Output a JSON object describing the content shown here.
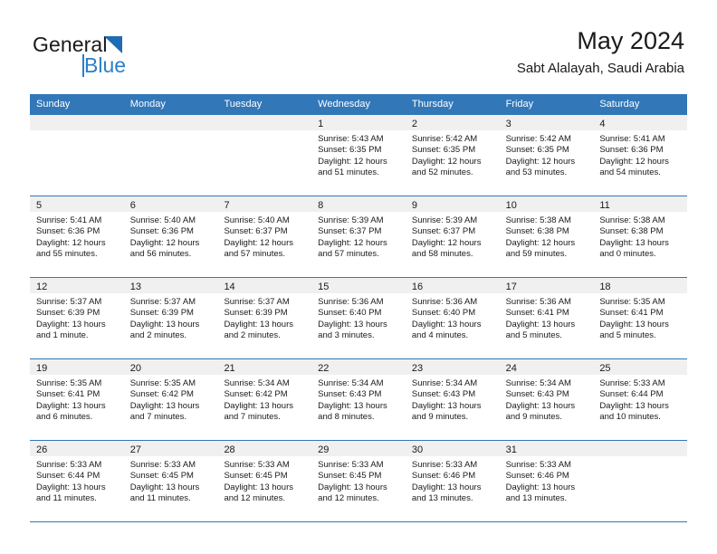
{
  "brand": {
    "name_top": "General",
    "name_bottom": "Blue",
    "color_black": "#1a1a1a",
    "color_blue": "#2a7fc9"
  },
  "header": {
    "title": "May 2024",
    "subtitle": "Sabt Alalayah, Saudi Arabia"
  },
  "calendar": {
    "header_bg": "#3277b8",
    "daynum_bg": "#f0f0f0",
    "day_names": [
      "Sunday",
      "Monday",
      "Tuesday",
      "Wednesday",
      "Thursday",
      "Friday",
      "Saturday"
    ],
    "weeks": [
      [
        {
          "day": "",
          "lines": []
        },
        {
          "day": "",
          "lines": []
        },
        {
          "day": "",
          "lines": []
        },
        {
          "day": "1",
          "lines": [
            "Sunrise: 5:43 AM",
            "Sunset: 6:35 PM",
            "Daylight: 12 hours",
            "and 51 minutes."
          ]
        },
        {
          "day": "2",
          "lines": [
            "Sunrise: 5:42 AM",
            "Sunset: 6:35 PM",
            "Daylight: 12 hours",
            "and 52 minutes."
          ]
        },
        {
          "day": "3",
          "lines": [
            "Sunrise: 5:42 AM",
            "Sunset: 6:35 PM",
            "Daylight: 12 hours",
            "and 53 minutes."
          ]
        },
        {
          "day": "4",
          "lines": [
            "Sunrise: 5:41 AM",
            "Sunset: 6:36 PM",
            "Daylight: 12 hours",
            "and 54 minutes."
          ]
        }
      ],
      [
        {
          "day": "5",
          "lines": [
            "Sunrise: 5:41 AM",
            "Sunset: 6:36 PM",
            "Daylight: 12 hours",
            "and 55 minutes."
          ]
        },
        {
          "day": "6",
          "lines": [
            "Sunrise: 5:40 AM",
            "Sunset: 6:36 PM",
            "Daylight: 12 hours",
            "and 56 minutes."
          ]
        },
        {
          "day": "7",
          "lines": [
            "Sunrise: 5:40 AM",
            "Sunset: 6:37 PM",
            "Daylight: 12 hours",
            "and 57 minutes."
          ]
        },
        {
          "day": "8",
          "lines": [
            "Sunrise: 5:39 AM",
            "Sunset: 6:37 PM",
            "Daylight: 12 hours",
            "and 57 minutes."
          ]
        },
        {
          "day": "9",
          "lines": [
            "Sunrise: 5:39 AM",
            "Sunset: 6:37 PM",
            "Daylight: 12 hours",
            "and 58 minutes."
          ]
        },
        {
          "day": "10",
          "lines": [
            "Sunrise: 5:38 AM",
            "Sunset: 6:38 PM",
            "Daylight: 12 hours",
            "and 59 minutes."
          ]
        },
        {
          "day": "11",
          "lines": [
            "Sunrise: 5:38 AM",
            "Sunset: 6:38 PM",
            "Daylight: 13 hours",
            "and 0 minutes."
          ]
        }
      ],
      [
        {
          "day": "12",
          "lines": [
            "Sunrise: 5:37 AM",
            "Sunset: 6:39 PM",
            "Daylight: 13 hours",
            "and 1 minute."
          ]
        },
        {
          "day": "13",
          "lines": [
            "Sunrise: 5:37 AM",
            "Sunset: 6:39 PM",
            "Daylight: 13 hours",
            "and 2 minutes."
          ]
        },
        {
          "day": "14",
          "lines": [
            "Sunrise: 5:37 AM",
            "Sunset: 6:39 PM",
            "Daylight: 13 hours",
            "and 2 minutes."
          ]
        },
        {
          "day": "15",
          "lines": [
            "Sunrise: 5:36 AM",
            "Sunset: 6:40 PM",
            "Daylight: 13 hours",
            "and 3 minutes."
          ]
        },
        {
          "day": "16",
          "lines": [
            "Sunrise: 5:36 AM",
            "Sunset: 6:40 PM",
            "Daylight: 13 hours",
            "and 4 minutes."
          ]
        },
        {
          "day": "17",
          "lines": [
            "Sunrise: 5:36 AM",
            "Sunset: 6:41 PM",
            "Daylight: 13 hours",
            "and 5 minutes."
          ]
        },
        {
          "day": "18",
          "lines": [
            "Sunrise: 5:35 AM",
            "Sunset: 6:41 PM",
            "Daylight: 13 hours",
            "and 5 minutes."
          ]
        }
      ],
      [
        {
          "day": "19",
          "lines": [
            "Sunrise: 5:35 AM",
            "Sunset: 6:41 PM",
            "Daylight: 13 hours",
            "and 6 minutes."
          ]
        },
        {
          "day": "20",
          "lines": [
            "Sunrise: 5:35 AM",
            "Sunset: 6:42 PM",
            "Daylight: 13 hours",
            "and 7 minutes."
          ]
        },
        {
          "day": "21",
          "lines": [
            "Sunrise: 5:34 AM",
            "Sunset: 6:42 PM",
            "Daylight: 13 hours",
            "and 7 minutes."
          ]
        },
        {
          "day": "22",
          "lines": [
            "Sunrise: 5:34 AM",
            "Sunset: 6:43 PM",
            "Daylight: 13 hours",
            "and 8 minutes."
          ]
        },
        {
          "day": "23",
          "lines": [
            "Sunrise: 5:34 AM",
            "Sunset: 6:43 PM",
            "Daylight: 13 hours",
            "and 9 minutes."
          ]
        },
        {
          "day": "24",
          "lines": [
            "Sunrise: 5:34 AM",
            "Sunset: 6:43 PM",
            "Daylight: 13 hours",
            "and 9 minutes."
          ]
        },
        {
          "day": "25",
          "lines": [
            "Sunrise: 5:33 AM",
            "Sunset: 6:44 PM",
            "Daylight: 13 hours",
            "and 10 minutes."
          ]
        }
      ],
      [
        {
          "day": "26",
          "lines": [
            "Sunrise: 5:33 AM",
            "Sunset: 6:44 PM",
            "Daylight: 13 hours",
            "and 11 minutes."
          ]
        },
        {
          "day": "27",
          "lines": [
            "Sunrise: 5:33 AM",
            "Sunset: 6:45 PM",
            "Daylight: 13 hours",
            "and 11 minutes."
          ]
        },
        {
          "day": "28",
          "lines": [
            "Sunrise: 5:33 AM",
            "Sunset: 6:45 PM",
            "Daylight: 13 hours",
            "and 12 minutes."
          ]
        },
        {
          "day": "29",
          "lines": [
            "Sunrise: 5:33 AM",
            "Sunset: 6:45 PM",
            "Daylight: 13 hours",
            "and 12 minutes."
          ]
        },
        {
          "day": "30",
          "lines": [
            "Sunrise: 5:33 AM",
            "Sunset: 6:46 PM",
            "Daylight: 13 hours",
            "and 13 minutes."
          ]
        },
        {
          "day": "31",
          "lines": [
            "Sunrise: 5:33 AM",
            "Sunset: 6:46 PM",
            "Daylight: 13 hours",
            "and 13 minutes."
          ]
        },
        {
          "day": "",
          "lines": []
        }
      ]
    ]
  }
}
